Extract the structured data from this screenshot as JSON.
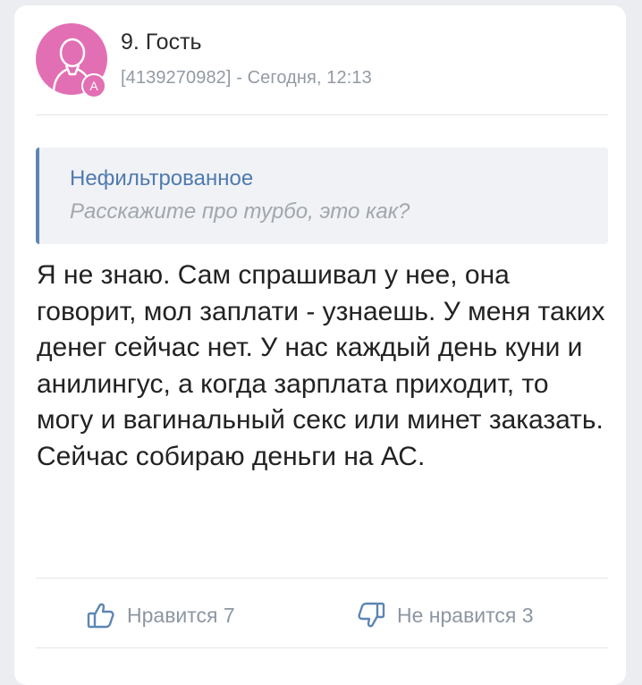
{
  "post": {
    "author_name": "9. Гость",
    "meta": "[4139270982] - Сегодня, 12:13",
    "badge_letter": "A",
    "quote": {
      "title": "Нефильтрованное",
      "text": "Расскажите про турбо, это как?"
    },
    "body": "Я не знаю. Сам спрашивал у нее, она говорит, мол заплати - узнаешь. У меня таких денег сейчас нет. У нас каждый день куни и анилингус, а когда зарплата приходит, то могу и вагинальный секс или минет заказать. Сейчас собираю деньги на АС."
  },
  "actions": {
    "like_label": "Нравится 7",
    "dislike_label": "Не нравится 3"
  },
  "colors": {
    "avatar": "#e26fb3",
    "accent": "#4f7ab0",
    "action_icon": "#5d86b3"
  },
  "icons": {
    "avatar": "user-silhouette-icon",
    "like": "thumbs-up-icon",
    "dislike": "thumbs-down-icon"
  }
}
